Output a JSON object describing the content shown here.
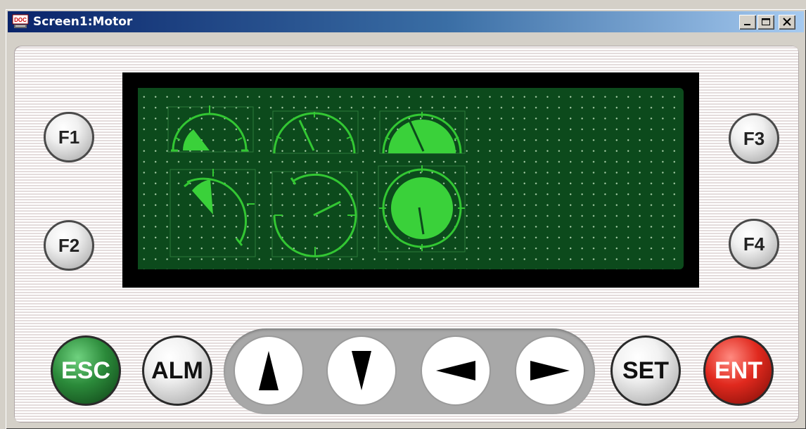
{
  "window": {
    "title": "Screen1:Motor",
    "app_icon": "doc-icon",
    "controls": [
      "minimize",
      "maximize",
      "close"
    ]
  },
  "panel": {
    "function_keys": [
      "F1",
      "F2",
      "F3",
      "F4"
    ],
    "bottom_keys": {
      "esc": "ESC",
      "alm": "ALM",
      "set": "SET",
      "ent": "ENT"
    },
    "arrow_keys": [
      "up-arrow",
      "down-arrow",
      "left-arrow",
      "right-arrow"
    ]
  },
  "colors": {
    "lcd_background": "#0c4a1c",
    "gauge_stroke": "#33c733",
    "gauge_fill": "#3ad13a",
    "esc_key": "#2b8a3a",
    "ent_key": "#e0291e",
    "title_bar": "#0a246a"
  }
}
